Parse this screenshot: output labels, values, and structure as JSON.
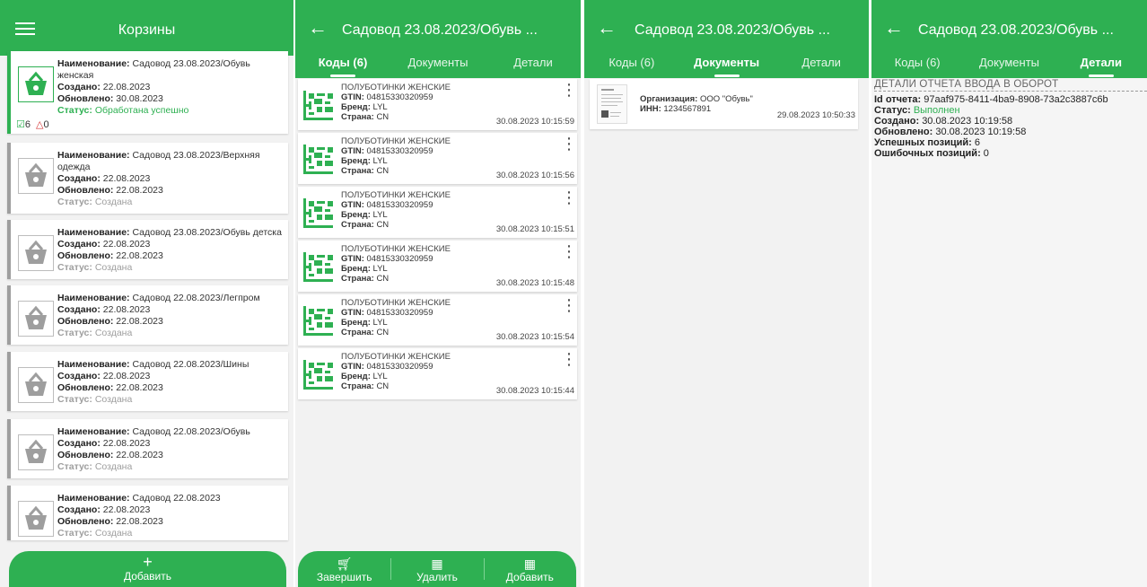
{
  "screen1": {
    "title": "Корзины",
    "add_label": "Добавить",
    "labels": {
      "name": "Наименование",
      "created": "Создано",
      "updated": "Обновлено",
      "status": "Статус"
    },
    "baskets": [
      {
        "name": "Садовод 23.08.2023/Обувь женская",
        "created": "22.08.2023",
        "updated": "30.08.2023",
        "status": "Обработана успешно",
        "ok_count": "6",
        "err_count": "0"
      },
      {
        "name": "Садовод 23.08.2023/Верхняя одежда",
        "created": "22.08.2023",
        "updated": "22.08.2023",
        "status": "Создана"
      },
      {
        "name": "Садовод 23.08.2023/Обувь детска",
        "created": "22.08.2023",
        "updated": "22.08.2023",
        "status": "Создана"
      },
      {
        "name": "Садовод 22.08.2023/Легпром",
        "created": "22.08.2023",
        "updated": "22.08.2023",
        "status": "Создана"
      },
      {
        "name": "Садовод 22.08.2023/Шины",
        "created": "22.08.2023",
        "updated": "22.08.2023",
        "status": "Создана"
      },
      {
        "name": "Садовод 22.08.2023/Обувь",
        "created": "22.08.2023",
        "updated": "22.08.2023",
        "status": "Создана"
      },
      {
        "name": "Садовод 22.08.2023",
        "created": "22.08.2023",
        "updated": "22.08.2023",
        "status": "Создана"
      }
    ]
  },
  "detail_title": "Садовод 23.08.2023/Обувь ...",
  "tabs": [
    "Коды (6)",
    "Документы",
    "Детали"
  ],
  "screen2": {
    "labels": {
      "gtin": "GTIN",
      "brand": "Бренд",
      "country": "Страна"
    },
    "codes": [
      {
        "product": "ПОЛУБОТИНКИ ЖЕНСКИЕ",
        "gtin": "04815330320959",
        "brand": "LYL",
        "country": "CN",
        "time": "30.08.2023 10:15:59"
      },
      {
        "product": "ПОЛУБОТИНКИ ЖЕНСКИЕ",
        "gtin": "04815330320959",
        "brand": "LYL",
        "country": "CN",
        "time": "30.08.2023 10:15:56"
      },
      {
        "product": "ПОЛУБОТИНКИ ЖЕНСКИЕ",
        "gtin": "04815330320959",
        "brand": "LYL",
        "country": "CN",
        "time": "30.08.2023 10:15:51"
      },
      {
        "product": "ПОЛУБОТИНКИ ЖЕНСКИЕ",
        "gtin": "04815330320959",
        "brand": "LYL",
        "country": "CN",
        "time": "30.08.2023 10:15:48"
      },
      {
        "product": "ПОЛУБОТИНКИ ЖЕНСКИЕ",
        "gtin": "04815330320959",
        "brand": "LYL",
        "country": "CN",
        "time": "30.08.2023 10:15:54"
      },
      {
        "product": "ПОЛУБОТИНКИ ЖЕНСКИЕ",
        "gtin": "04815330320959",
        "brand": "LYL",
        "country": "CN",
        "time": "30.08.2023 10:15:44"
      }
    ],
    "actions": {
      "finish": "Завершить",
      "delete": "Удалить",
      "add": "Добавить"
    }
  },
  "screen3": {
    "doc": {
      "org_label": "Организация",
      "org": "ООО \"Обувь\"",
      "inn_label": "ИНН",
      "inn": "1234567891",
      "time": "29.08.2023 10:50:33"
    }
  },
  "screen4": {
    "heading": "ДЕТАЛИ ОТЧЕТА ВВОДА В ОБОРОТ",
    "report_id_label": "Id отчета",
    "report_id": "97aaf975-8411-4ba9-8908-73a2c3887c6b",
    "status_label": "Статус",
    "status": "Выполнен",
    "created_label": "Создано",
    "created": "30.08.2023 10:19:58",
    "updated_label": "Обновлено",
    "updated": "30.08.2023 10:19:58",
    "success_label": "Успешных позиций",
    "success": "6",
    "error_label": "Ошибочных позиций",
    "errors": "0"
  },
  "colors": {
    "accent": "#2eb052",
    "muted": "#9e9e9e",
    "error": "#d32f2f"
  }
}
